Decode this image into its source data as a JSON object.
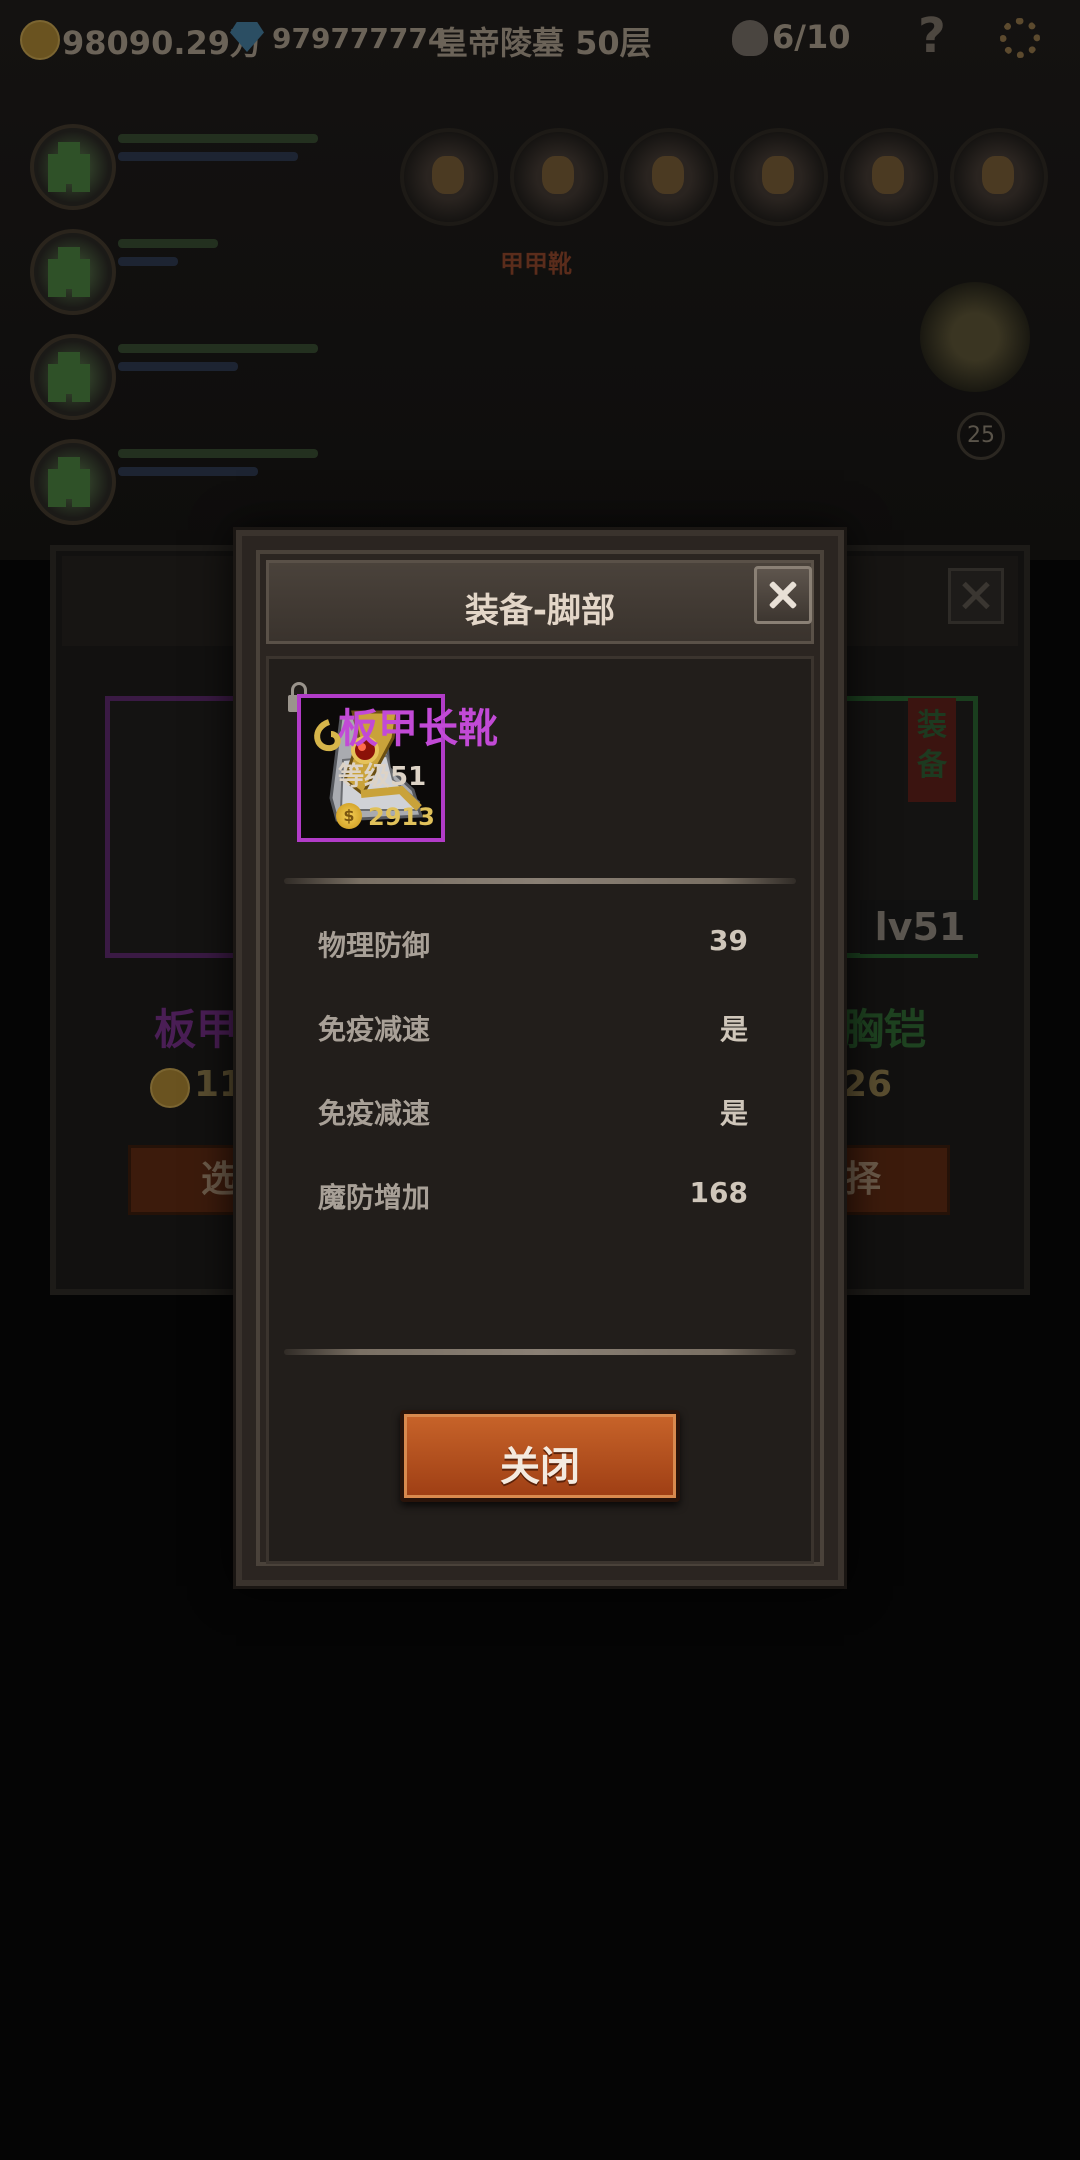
{
  "topbar": {
    "gold": "98090.29万",
    "gems": "979777774",
    "stage": "皇帝陵墓 50层",
    "skulls": "6/10",
    "help": "?"
  },
  "background": {
    "slot_label": "甲甲靴",
    "boss_level": "25",
    "left_card": {
      "name": "板甲",
      "price": "11",
      "button": "选"
    },
    "right_card": {
      "name": "胸铠",
      "price": "26",
      "button": "择",
      "tag": "装备",
      "level": "lv51"
    }
  },
  "modal": {
    "title": "装备-脚部",
    "item": {
      "name": "板甲长靴",
      "level": "等级51",
      "price": "2913",
      "frame_color": "#b23cc8",
      "name_color": "#c24ad6"
    },
    "stats": [
      {
        "label": "物理防御",
        "value": "39"
      },
      {
        "label": "免疫减速",
        "value": "是"
      },
      {
        "label": "免疫减速",
        "value": "是"
      },
      {
        "label": "魔防增加",
        "value": "168"
      }
    ],
    "close_button": "关闭"
  },
  "icons": [
    "gold-coin-icon",
    "gem-icon",
    "skull-icon",
    "help-icon",
    "gear-icon",
    "lock-icon",
    "close-icon",
    "boots-icon"
  ]
}
